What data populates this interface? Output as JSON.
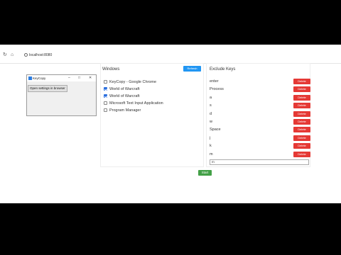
{
  "browser": {
    "url": "localhost:8080"
  },
  "keycopy_window": {
    "title": "KeyCopy",
    "open_settings_label": "Open settings in browser"
  },
  "windows_panel": {
    "title": "Windows",
    "refresh_label": "Refresh",
    "items": [
      {
        "label": "KeyCopy - Google Chrome",
        "checked": false
      },
      {
        "label": "World of Warcraft",
        "checked": true
      },
      {
        "label": "World of Warcraft",
        "checked": true
      },
      {
        "label": "Microsoft Text Input Application",
        "checked": false
      },
      {
        "label": "Program Manager",
        "checked": false
      }
    ]
  },
  "exclude_panel": {
    "title": "Exclude Keys",
    "delete_label": "Delete",
    "keys": [
      "enter",
      "Process",
      "a",
      "s",
      "d",
      "w",
      "Space",
      "j",
      "k",
      "m"
    ],
    "input_value": "m"
  },
  "start_label": "Start",
  "colors": {
    "refresh": "#2196f3",
    "delete": "#e53935",
    "start": "#43a047",
    "checkbox_checked": "#2b6fde"
  }
}
